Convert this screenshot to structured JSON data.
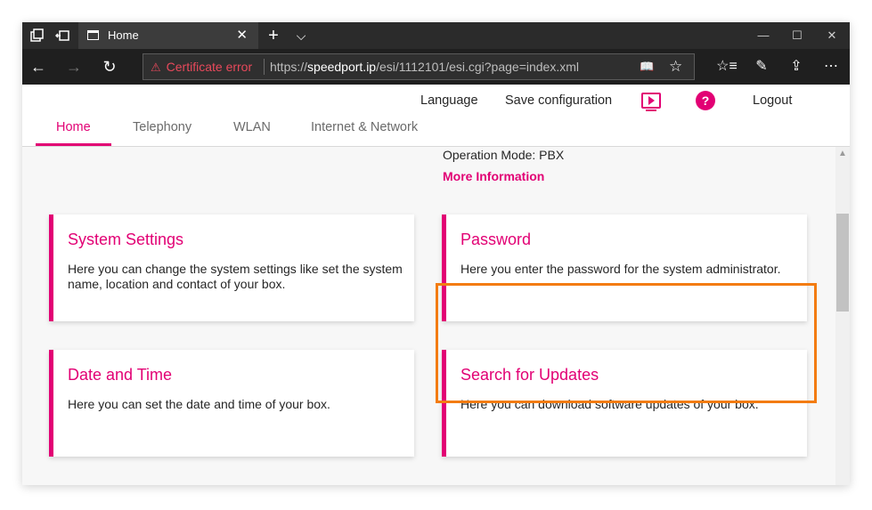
{
  "browser": {
    "tab_title": "Home",
    "tab_close": "✕",
    "new_tab": "+",
    "tab_list": "⌵",
    "window_controls": {
      "minimize": "—",
      "maximize": "☐",
      "close": "✕"
    },
    "nav": {
      "back": "←",
      "forward": "→",
      "refresh": "↻"
    },
    "cert_warning_icon": "⚠",
    "cert_warning": "Certificate error",
    "url_prefix": "https://",
    "url_host": "speedport.ip",
    "url_path": "/esi/1112101/esi.cgi?page=index.xml",
    "reading_view_icon": "📖",
    "favorite_icon": "☆",
    "toolbar_icons": {
      "favorites_hub": "☆≡",
      "notes": "✎",
      "share": "⇪",
      "more": "⋯"
    }
  },
  "header": {
    "links": {
      "language": "Language",
      "save_configuration": "Save configuration",
      "help": "?",
      "logout": "Logout"
    },
    "tabs": [
      {
        "label": "Home"
      },
      {
        "label": "Telephony"
      },
      {
        "label": "WLAN"
      },
      {
        "label": "Internet & Network"
      }
    ]
  },
  "status": {
    "operation_mode": "Operation Mode: PBX",
    "more_information": "More Information"
  },
  "cards": [
    {
      "title": "System Settings",
      "description": "Here you can change the system settings like set the system name, location and contact of your box."
    },
    {
      "title": "Password",
      "description": "Here you enter the password for the system administrator."
    },
    {
      "title": "Date and Time",
      "description": "Here you can set the date and time of your box."
    },
    {
      "title": "Search for Updates",
      "description": "Here you can download software updates of your box."
    }
  ],
  "colors": {
    "brand_magenta": "#e20074",
    "highlight_orange": "#f37c12",
    "titlebar": "#2b2b2b",
    "addressbar": "#1f1f1f",
    "cert_error": "#e8495b"
  }
}
